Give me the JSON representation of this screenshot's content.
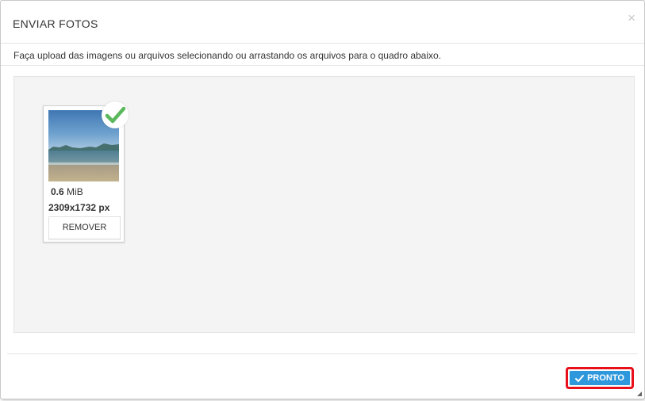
{
  "dialog": {
    "title": "ENVIAR FOTOS",
    "close_icon": "close-icon",
    "close_glyph": "×",
    "instructions": "Faça upload das imagens ou arquivos selecionando ou arrastando os arquivos para o quadro abaixo."
  },
  "files": [
    {
      "thumbnail": "beach-photo",
      "status_icon": "check-icon",
      "size_value": "0.6",
      "size_unit": "MiB",
      "dimensions": "2309x1732 px",
      "remove_label": "REMOVER"
    }
  ],
  "footer": {
    "done_label": "PRONTO",
    "done_icon": "check-icon"
  },
  "colors": {
    "accent": "#2f97dc",
    "highlight_border": "#e8101a",
    "success": "#5cb85c"
  }
}
